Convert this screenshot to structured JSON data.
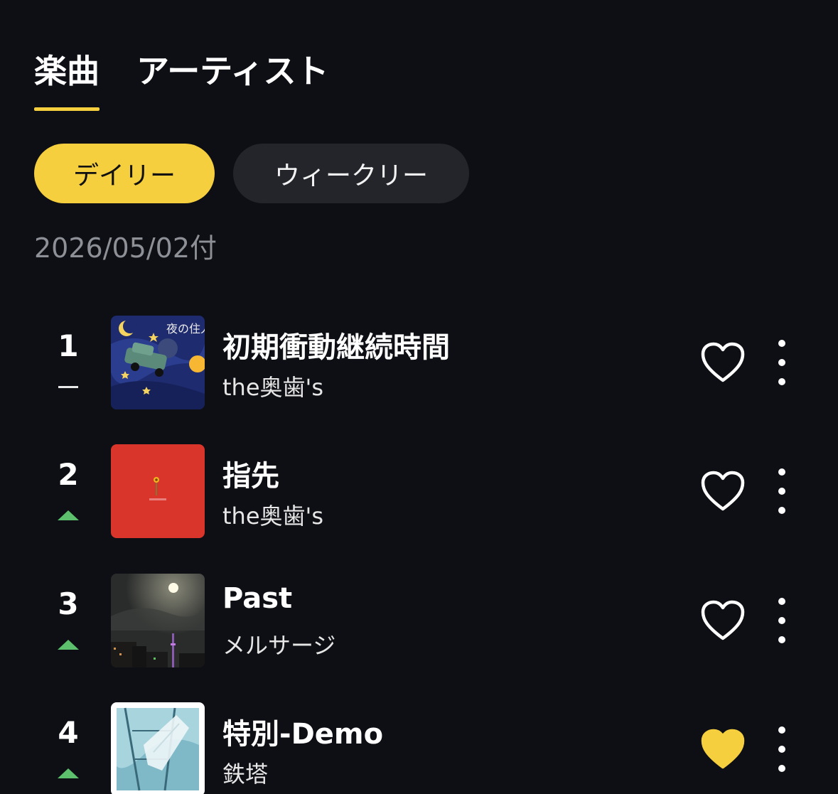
{
  "tabs": [
    {
      "label": "楽曲",
      "active": true
    },
    {
      "label": "アーティスト",
      "active": false
    }
  ],
  "period_filters": [
    {
      "label": "デイリー",
      "selected": true
    },
    {
      "label": "ウィークリー",
      "selected": false
    }
  ],
  "chart_date": "2026/05/02付",
  "colors": {
    "accent": "#f6cf3f",
    "background": "#0e0f14",
    "trend_up": "#5cc06c",
    "date_text": "#8e9097"
  },
  "rankings": [
    {
      "rank": "1",
      "trend": "same",
      "title": "初期衝動継続時間",
      "artist": "the奥歯's",
      "liked": false,
      "art_icon": "night-sky-car-artwork"
    },
    {
      "rank": "2",
      "trend": "up",
      "title": "指先",
      "artist": "the奥歯's",
      "liked": false,
      "art_icon": "red-sunflower-artwork"
    },
    {
      "rank": "3",
      "trend": "up",
      "title": "Past",
      "artist": "メルサージ",
      "liked": false,
      "art_icon": "night-moon-city-photo"
    },
    {
      "rank": "4",
      "trend": "up",
      "title": "特別-Demo",
      "artist": "鉄塔",
      "liked": true,
      "art_icon": "steel-tower-photo"
    }
  ]
}
